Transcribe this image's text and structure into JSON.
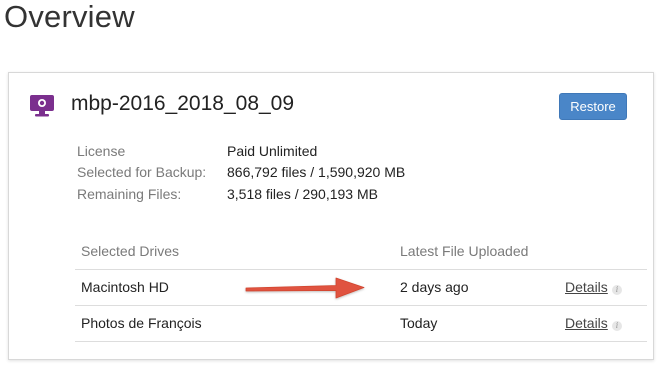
{
  "page": {
    "title": "Overview"
  },
  "computer": {
    "name": "mbp-2016_2018_08_09",
    "icon": "computer-monitor-icon",
    "restore_label": "Restore",
    "accent_color": "#7b2f8e",
    "button_color": "#4a86c8"
  },
  "info": [
    {
      "label": "License",
      "value": "Paid Unlimited"
    },
    {
      "label": "Selected for Backup:",
      "value": "866,792 files / 1,590,920 MB"
    },
    {
      "label": "Remaining Files:",
      "value": "3,518 files / 290,193 MB"
    }
  ],
  "drives": {
    "headers": {
      "drive": "Selected Drives",
      "latest": "Latest File Uploaded"
    },
    "rows": [
      {
        "name": "Macintosh HD",
        "latest": "2 days ago",
        "details": "Details"
      },
      {
        "name": "Photos de François",
        "latest": "Today",
        "details": "Details"
      }
    ]
  },
  "annotation": {
    "arrow_color": "#e0533f"
  }
}
